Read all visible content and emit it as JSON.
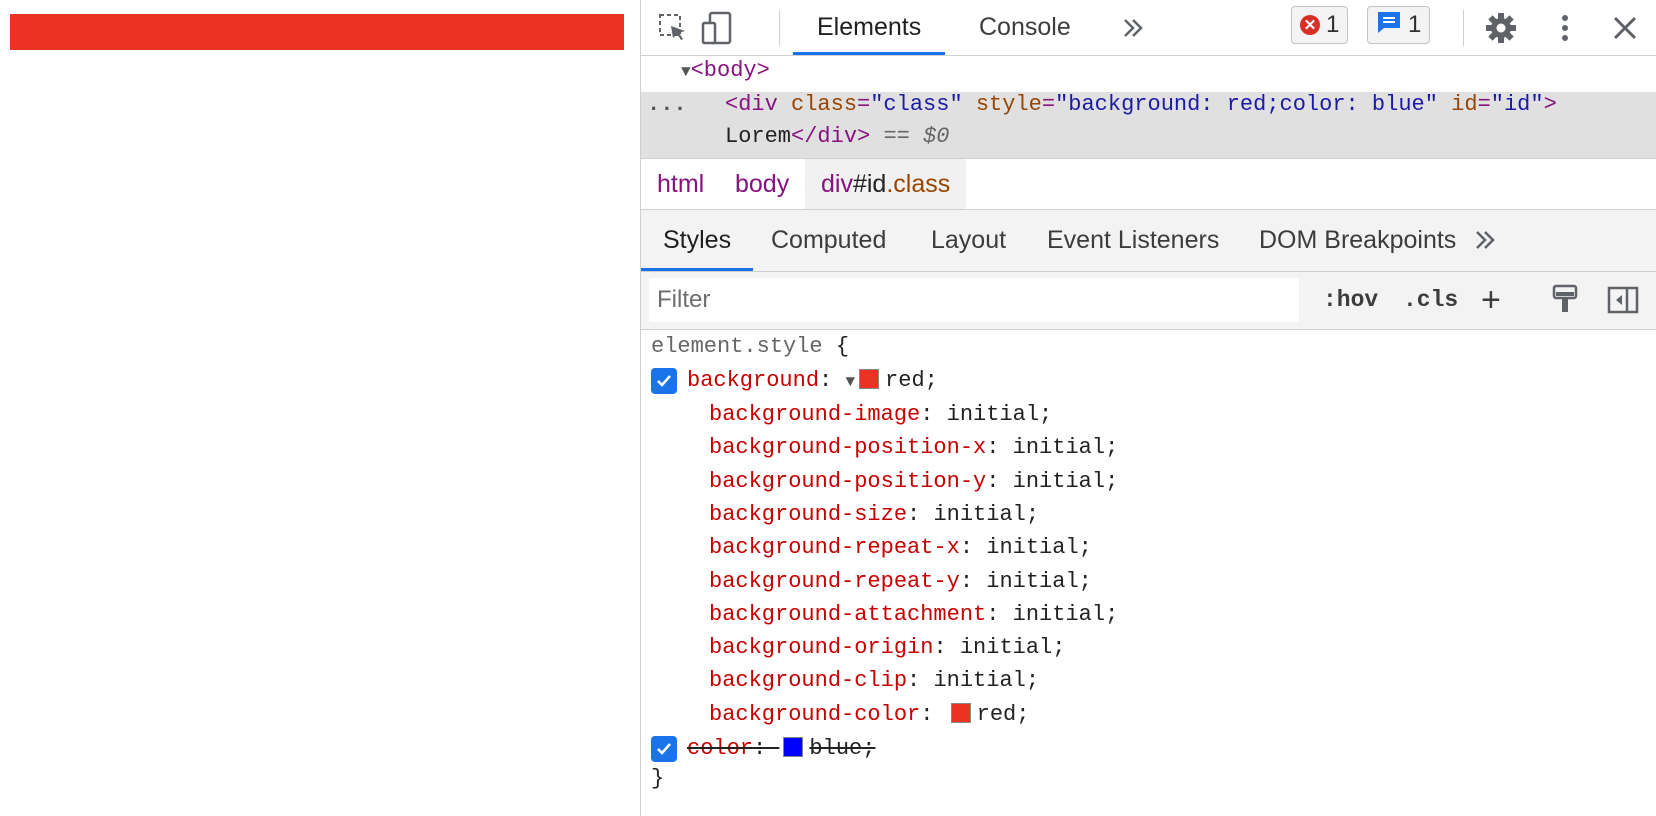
{
  "page": {
    "bar_color": "#ec3323"
  },
  "devtools": {
    "tabs": [
      "Elements",
      "Console"
    ],
    "more_tabs_icon": "double-chevron-icon",
    "badges": {
      "errors": "1",
      "messages": "1"
    },
    "dom": {
      "body_tag": "<body>",
      "div_open": "<div",
      "attr_class": "class",
      "val_class": "\"class\"",
      "attr_style": "style",
      "val_style": "\"background: red;color: blue\"",
      "attr_id": "id",
      "val_id": "\"id\"",
      "gt": ">",
      "text": "Lorem",
      "div_close": "</div>",
      "eq": "==",
      "dollar": "$0",
      "ellipsis": "..."
    },
    "breadcrumbs": {
      "html": "html",
      "body": "body",
      "div_tag": "div",
      "div_hash": "#id",
      "div_cls": ".class"
    },
    "subtabs": [
      "Styles",
      "Computed",
      "Layout",
      "Event Listeners",
      "DOM Breakpoints"
    ],
    "filter": {
      "placeholder": "Filter",
      "hov": ":hov",
      "cls": ".cls",
      "plus": "+"
    },
    "styles": {
      "selector": "element.style",
      "open_brace": "{",
      "close_brace": "}",
      "background_prop": "background",
      "background_val": "red;",
      "background_color": "#ec3323",
      "longhands": [
        {
          "name": "background-image",
          "value": "initial;"
        },
        {
          "name": "background-position-x",
          "value": "initial;"
        },
        {
          "name": "background-position-y",
          "value": "initial;"
        },
        {
          "name": "background-size",
          "value": "initial;"
        },
        {
          "name": "background-repeat-x",
          "value": "initial;"
        },
        {
          "name": "background-repeat-y",
          "value": "initial;"
        },
        {
          "name": "background-attachment",
          "value": "initial;"
        },
        {
          "name": "background-origin",
          "value": "initial;"
        },
        {
          "name": "background-clip",
          "value": "initial;"
        }
      ],
      "bgcolor_prop": "background-color",
      "bgcolor_val": "red;",
      "color_prop": "color",
      "color_val": "blue;",
      "color_swatch": "#0000ff"
    }
  }
}
